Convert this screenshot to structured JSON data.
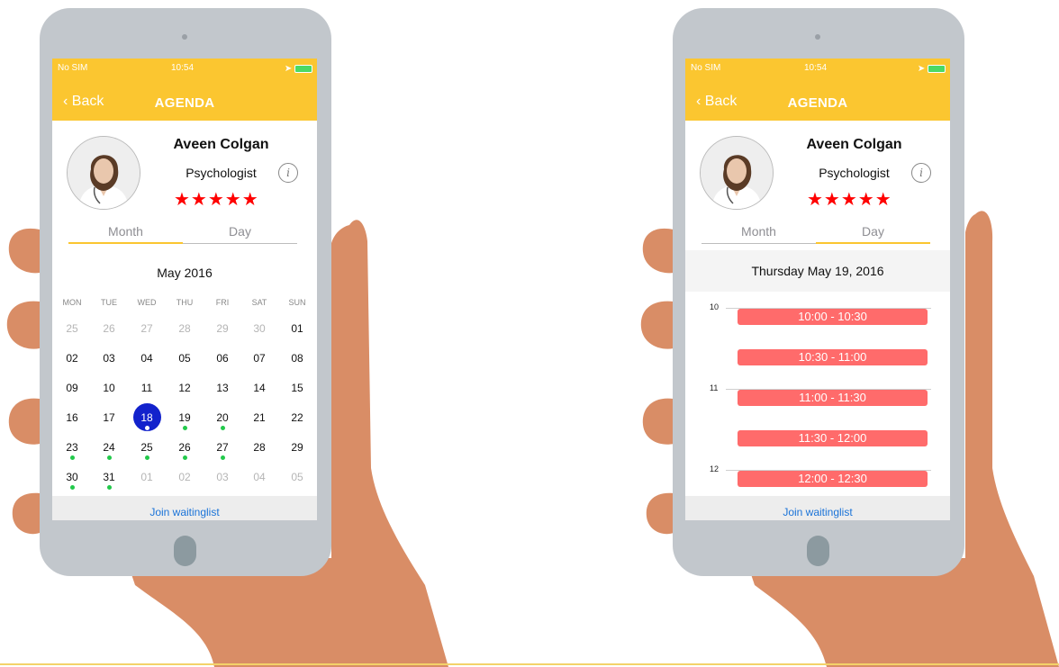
{
  "status_bar": {
    "carrier": "No SIM",
    "time": "10:54"
  },
  "nav": {
    "back_label": "Back",
    "title": "AGENDA"
  },
  "profile": {
    "name": "Aveen Colgan",
    "role": "Psychologist",
    "rating_stars": 5
  },
  "tabs": {
    "month": "Month",
    "day": "Day"
  },
  "month_view": {
    "title": "May 2016",
    "weekdays": [
      "MON",
      "TUE",
      "WED",
      "THU",
      "FRI",
      "SAT",
      "SUN"
    ],
    "weeks": [
      [
        {
          "d": "25",
          "muted": true
        },
        {
          "d": "26",
          "muted": true
        },
        {
          "d": "27",
          "muted": true
        },
        {
          "d": "28",
          "muted": true
        },
        {
          "d": "29",
          "muted": true
        },
        {
          "d": "30",
          "muted": true
        },
        {
          "d": "01"
        }
      ],
      [
        {
          "d": "02"
        },
        {
          "d": "03"
        },
        {
          "d": "04"
        },
        {
          "d": "05"
        },
        {
          "d": "06"
        },
        {
          "d": "07"
        },
        {
          "d": "08"
        }
      ],
      [
        {
          "d": "09"
        },
        {
          "d": "10"
        },
        {
          "d": "11"
        },
        {
          "d": "12"
        },
        {
          "d": "13"
        },
        {
          "d": "14"
        },
        {
          "d": "15"
        }
      ],
      [
        {
          "d": "16"
        },
        {
          "d": "17"
        },
        {
          "d": "18",
          "selected": true
        },
        {
          "d": "19",
          "dot": true
        },
        {
          "d": "20",
          "dot": true
        },
        {
          "d": "21"
        },
        {
          "d": "22"
        }
      ],
      [
        {
          "d": "23",
          "dot": true
        },
        {
          "d": "24",
          "dot": true
        },
        {
          "d": "25",
          "dot": true
        },
        {
          "d": "26",
          "dot": true
        },
        {
          "d": "27",
          "dot": true
        },
        {
          "d": "28"
        },
        {
          "d": "29"
        }
      ],
      [
        {
          "d": "30",
          "dot": true
        },
        {
          "d": "31",
          "dot": true
        },
        {
          "d": "01",
          "muted": true
        },
        {
          "d": "02",
          "muted": true
        },
        {
          "d": "03",
          "muted": true
        },
        {
          "d": "04",
          "muted": true
        },
        {
          "d": "05",
          "muted": true
        }
      ]
    ]
  },
  "day_view": {
    "date": "Thursday May 19, 2016",
    "hours": [
      "10",
      "11",
      "12"
    ],
    "slots": [
      "10:00 - 10:30",
      "10:30 - 11:00",
      "11:00 - 11:30",
      "11:30 - 12:00",
      "12:00 - 12:30"
    ]
  },
  "join_label": "Join waitinglist",
  "colors": {
    "header": "#fbc630",
    "selected_day": "#1222cc",
    "availability_dot": "#22c94b",
    "slot": "#ff6b6b",
    "link": "#1a73d8",
    "stars": "#ff0000"
  }
}
